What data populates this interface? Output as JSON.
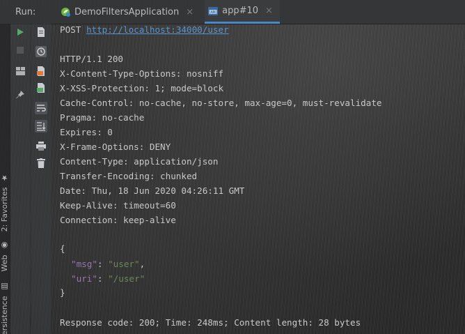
{
  "tabbar": {
    "run_label": "Run:",
    "tabs": [
      {
        "label": "DemoFiltersApplication",
        "icon": "spring-boot-icon",
        "close": "×",
        "active": false
      },
      {
        "label": "app#10",
        "icon": "http-request-icon",
        "close": "×",
        "active": true
      }
    ]
  },
  "side_strip": {
    "favorites": "2: Favorites",
    "web": "Web",
    "persistence": "Persistence"
  },
  "toolbar": {
    "col1": [
      "run-icon",
      "stop-icon",
      "layout-icon",
      "pin-icon"
    ],
    "col2": [
      "file-icon",
      "history-icon",
      "html-file-icon",
      "json-file-icon",
      "soft-wrap-icon",
      "scroll-to-end-icon",
      "print-icon",
      "trash-icon"
    ]
  },
  "console": {
    "request_method": "POST",
    "request_url": "http://localhost:34000/user",
    "status_line": "HTTP/1.1 200",
    "headers": [
      "X-Content-Type-Options: nosniff",
      "X-XSS-Protection: 1; mode=block",
      "Cache-Control: no-cache, no-store, max-age=0, must-revalidate",
      "Pragma: no-cache",
      "Expires: 0",
      "X-Frame-Options: DENY",
      "Content-Type: application/json",
      "Transfer-Encoding: chunked",
      "Date: Thu, 18 Jun 2020 04:26:11 GMT",
      "Keep-Alive: timeout=60",
      "Connection: keep-alive"
    ],
    "body_open": "{",
    "body_lines": [
      {
        "key": "\"msg\"",
        "sep": ": ",
        "value": "\"user\"",
        "trail": ","
      },
      {
        "key": "\"uri\"",
        "sep": ": ",
        "value": "\"/user\"",
        "trail": ""
      }
    ],
    "body_close": "}",
    "summary": "Response code: 200; Time: 248ms; Content length: 28 bytes"
  },
  "colors": {
    "link": "#5994ce",
    "json_key": "#9876aa",
    "json_string": "#6a8759",
    "run_green": "#59a869",
    "tab_underline": "#4a88c7"
  }
}
